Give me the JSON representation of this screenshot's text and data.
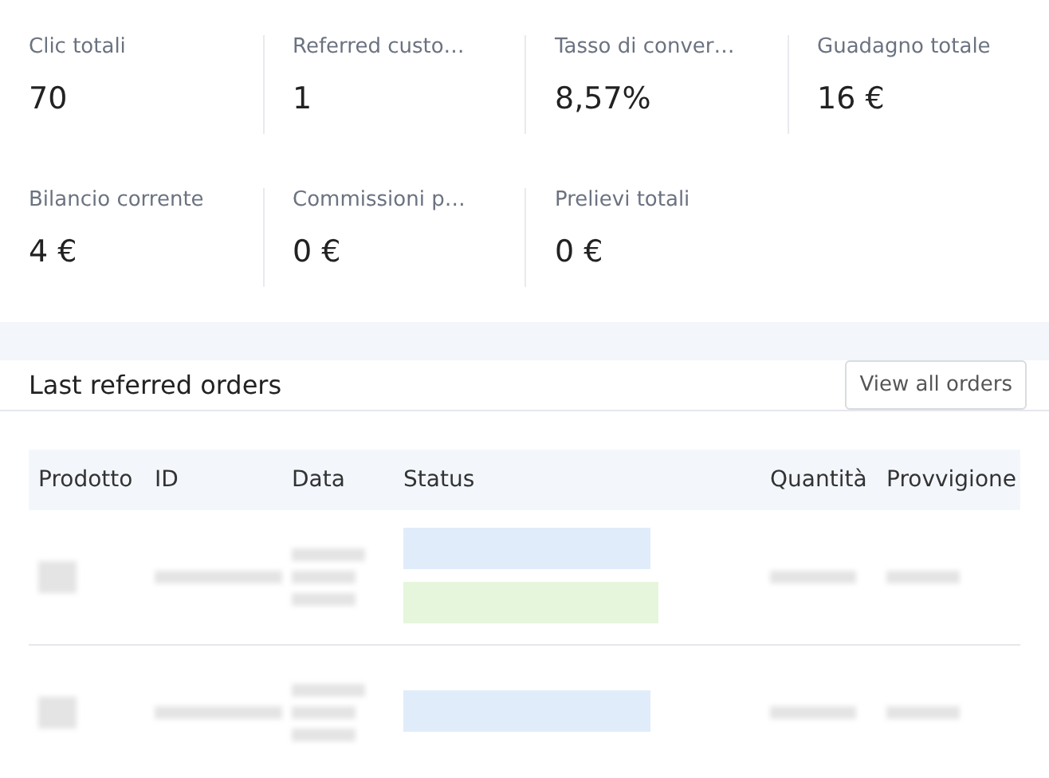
{
  "stats": [
    {
      "label": "Clic totali",
      "value": "70"
    },
    {
      "label": "Referred custo…",
      "value": "1"
    },
    {
      "label": "Tasso di conver…",
      "value": "8,57%"
    },
    {
      "label": "Guadagno totale",
      "value": "16 €"
    },
    {
      "label": "Bilancio corrente",
      "value": "4 €"
    },
    {
      "label": "Commissioni p…",
      "value": "0 €"
    },
    {
      "label": "Prelievi totali",
      "value": "0 €"
    }
  ],
  "orders": {
    "title": "Last referred orders",
    "button": "View all orders",
    "columns": [
      "Prodotto",
      "ID",
      "Data",
      "Status",
      "Quantità",
      "Provvigione"
    ],
    "rows": [
      {
        "kind": "redacted",
        "badges": [
          {
            "color": "#e1ecfb"
          },
          {
            "color": "#e5f6dc"
          }
        ]
      },
      {
        "kind": "redacted",
        "badges": [
          {
            "color": "#e1ecfb"
          }
        ]
      }
    ]
  }
}
